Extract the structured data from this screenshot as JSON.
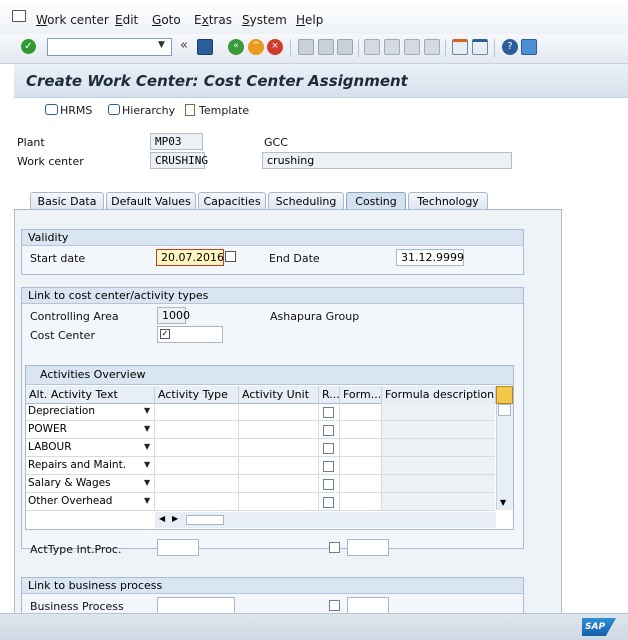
{
  "menu": [
    "Work center",
    "Edit",
    "Goto",
    "Extras",
    "System",
    "Help"
  ],
  "menu_mnemonic": [
    "W",
    "E",
    "G",
    "x",
    "S",
    "H"
  ],
  "page_title": "Create Work Center: Cost Center Assignment",
  "app_toolbar": {
    "hrms": "HRMS",
    "hierarchy": "Hierarchy",
    "template": "Template"
  },
  "header": {
    "plant_label": "Plant",
    "plant_value": "MP03",
    "plant_desc": "GCC",
    "wc_label": "Work center",
    "wc_value": "CRUSHING",
    "wc_desc": "crushing"
  },
  "tabs": [
    "Basic Data",
    "Default Values",
    "Capacities",
    "Scheduling",
    "Costing",
    "Technology"
  ],
  "active_tab": "Costing",
  "validity": {
    "title": "Validity",
    "start_label": "Start date",
    "start_value": "20.07.2016",
    "end_label": "End Date",
    "end_value": "31.12.9999"
  },
  "link_cc": {
    "title": "Link to cost center/activity types",
    "ca_label": "Controlling Area",
    "ca_value": "1000",
    "ca_desc": "Ashapura Group",
    "cc_label": "Cost Center"
  },
  "activities": {
    "title": "Activities Overview",
    "columns": [
      "Alt. Activity Text",
      "Activity Type",
      "Activity Unit",
      "R...",
      "Form...",
      "Formula description"
    ],
    "rows": [
      "Depreciation",
      "POWER",
      "LABOUR",
      "Repairs and Maint.",
      "Salary & Wages",
      "Other Overhead"
    ]
  },
  "acttype_label": "ActType Int.Proc.",
  "business": {
    "title": "Link to business process",
    "bp_label": "Business Process"
  },
  "colors": {
    "accent": "#1d2b3a",
    "tab_active": "#d4e2f0",
    "field_highlight": "#fff7c0"
  },
  "icons": [
    "enter-check-icon",
    "back-icon",
    "exit-icon",
    "cancel-icon",
    "save-icon",
    "print-icon",
    "find-icon",
    "help-icon",
    "sap-logo"
  ]
}
